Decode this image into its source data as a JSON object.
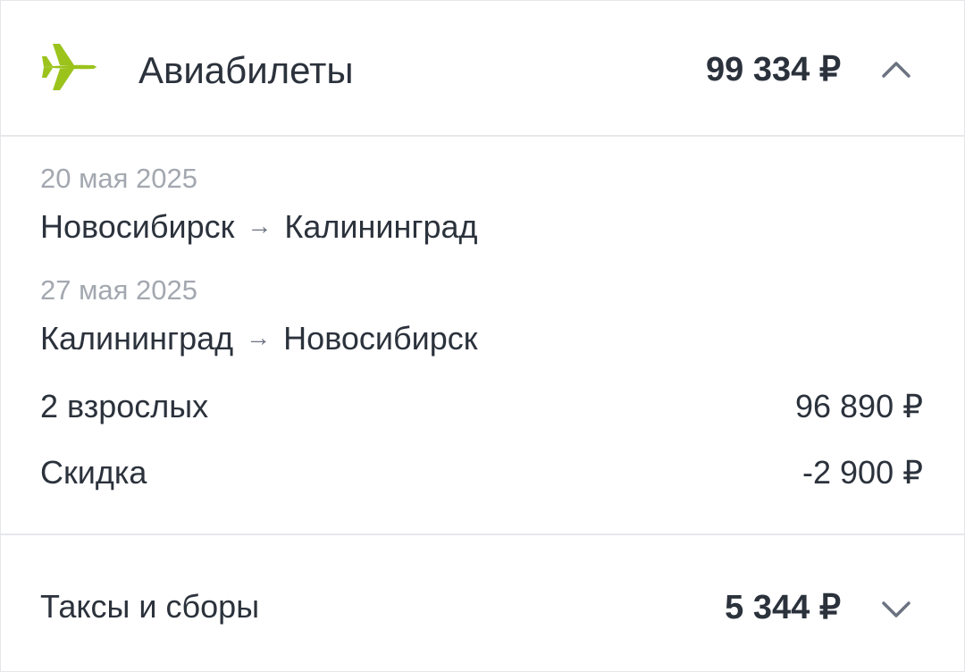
{
  "flights": {
    "icon": "airplane-icon",
    "title": "Авиабилеты",
    "total": "99 334 ₽",
    "legs": [
      {
        "date": "20 мая 2025",
        "from": "Новосибирск",
        "to": "Калининград"
      },
      {
        "date": "27 мая 2025",
        "from": "Калининград",
        "to": "Новосибирск"
      }
    ],
    "passengers_label": "2 взрослых",
    "passengers_value": "96 890 ₽",
    "discount_label": "Скидка",
    "discount_value": "-2 900 ₽",
    "arrow": "→"
  },
  "taxes": {
    "label": "Таксы и сборы",
    "total": "5 344 ₽"
  },
  "colors": {
    "accent": "#9bc31c",
    "text": "#2b323c",
    "muted": "#a3a8b0",
    "divider": "#e6e8eb"
  }
}
